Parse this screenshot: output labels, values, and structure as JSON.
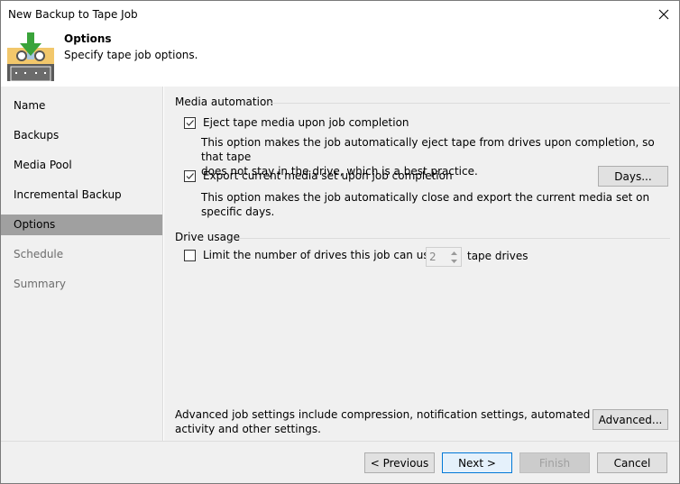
{
  "window": {
    "title": "New Backup to Tape Job",
    "close_icon": "close-icon"
  },
  "header": {
    "icon": "tape-download-icon",
    "title": "Options",
    "subtitle": "Specify tape job options."
  },
  "sidebar": {
    "items": [
      {
        "label": "Name",
        "state": "normal"
      },
      {
        "label": "Backups",
        "state": "normal"
      },
      {
        "label": "Media Pool",
        "state": "normal"
      },
      {
        "label": "Incremental Backup",
        "state": "normal"
      },
      {
        "label": "Options",
        "state": "active"
      },
      {
        "label": "Schedule",
        "state": "disabled"
      },
      {
        "label": "Summary",
        "state": "disabled"
      }
    ]
  },
  "media_automation": {
    "group_title": "Media automation",
    "eject": {
      "label": "Eject tape media upon job completion",
      "checked": true,
      "description_line1": "This option makes the job automatically eject tape from drives upon completion, so that tape",
      "description_line2": "does not stay in the drive, which is a best practice."
    },
    "export": {
      "label": "Export current media set upon job completion",
      "checked": true,
      "button_label": "Days...",
      "description": "This option makes the job automatically close and export the current media set on specific days."
    }
  },
  "drive_usage": {
    "group_title": "Drive usage",
    "limit": {
      "label": "Limit the number of drives this job can use to:",
      "checked": false,
      "value": "2",
      "suffix": "tape drives"
    }
  },
  "advanced": {
    "description_line1": "Advanced job settings include compression, notification settings, automated post-job",
    "description_line2": "activity and other settings.",
    "button_label": "Advanced..."
  },
  "footer": {
    "previous_label": "< Previous",
    "next_label": "Next >",
    "finish_label": "Finish",
    "cancel_label": "Cancel"
  }
}
